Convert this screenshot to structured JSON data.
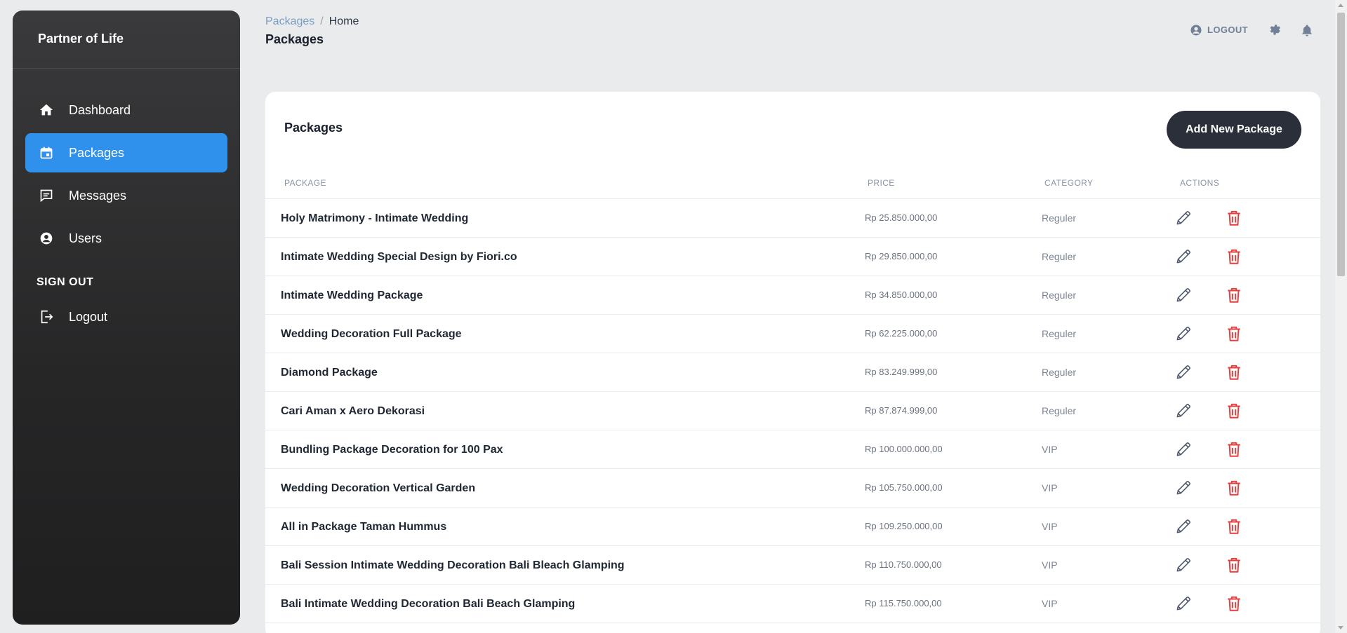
{
  "brand": "Partner of Life",
  "sidebar": {
    "items": [
      {
        "label": "Dashboard",
        "icon": "home-icon"
      },
      {
        "label": "Packages",
        "icon": "calendar-icon",
        "active": true
      },
      {
        "label": "Messages",
        "icon": "message-icon"
      },
      {
        "label": "Users",
        "icon": "user-circle-icon"
      }
    ],
    "section_title": "SIGN OUT",
    "logout_label": "Logout"
  },
  "breadcrumb": {
    "parent": "Packages",
    "separator": "/",
    "current": "Home"
  },
  "page_title": "Packages",
  "topbar": {
    "logout_label": "LOGOUT"
  },
  "card": {
    "title": "Packages",
    "add_button": "Add New Package",
    "columns": {
      "package": "PACKAGE",
      "price": "PRICE",
      "category": "CATEGORY",
      "actions": "ACTIONS"
    },
    "rows": [
      {
        "name": "Holy Matrimony - Intimate Wedding",
        "price": "Rp 25.850.000,00",
        "category": "Reguler"
      },
      {
        "name": "Intimate Wedding Special Design by Fiori.co",
        "price": "Rp 29.850.000,00",
        "category": "Reguler"
      },
      {
        "name": "Intimate Wedding Package",
        "price": "Rp 34.850.000,00",
        "category": "Reguler"
      },
      {
        "name": "Wedding Decoration Full Package",
        "price": "Rp 62.225.000,00",
        "category": "Reguler"
      },
      {
        "name": "Diamond Package",
        "price": "Rp 83.249.999,00",
        "category": "Reguler"
      },
      {
        "name": "Cari Aman x Aero Dekorasi",
        "price": "Rp 87.874.999,00",
        "category": "Reguler"
      },
      {
        "name": "Bundling Package Decoration for 100 Pax",
        "price": "Rp 100.000.000,00",
        "category": "VIP"
      },
      {
        "name": "Wedding Decoration Vertical Garden",
        "price": "Rp 105.750.000,00",
        "category": "VIP"
      },
      {
        "name": "All in Package Taman Hummus",
        "price": "Rp 109.250.000,00",
        "category": "VIP"
      },
      {
        "name": "Bali Session Intimate Wedding Decoration Bali Bleach Glamping",
        "price": "Rp 110.750.000,00",
        "category": "VIP"
      },
      {
        "name": "Bali Intimate Wedding Decoration Bali Beach Glamping",
        "price": "Rp 115.750.000,00",
        "category": "VIP"
      }
    ]
  },
  "colors": {
    "accent": "#2f91eb",
    "delete": "#e53e3e",
    "button_dark": "#2b2f3a"
  }
}
